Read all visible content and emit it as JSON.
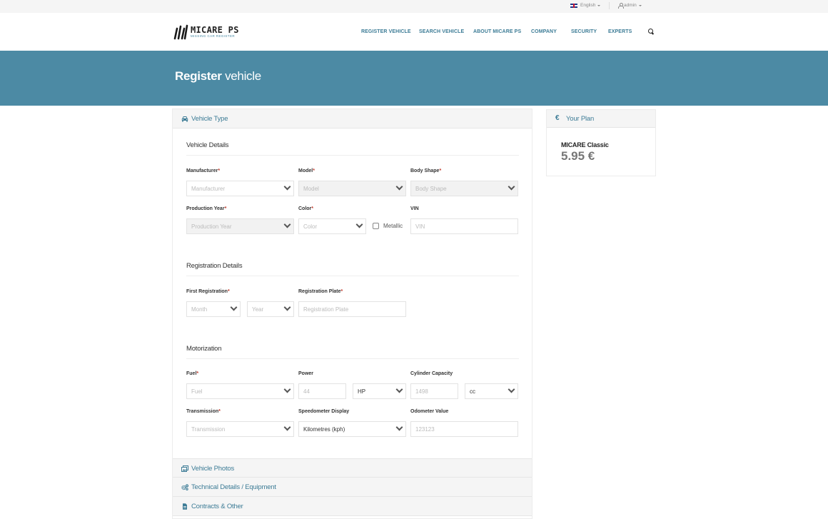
{
  "topbar": {
    "language": "English",
    "user": "admin"
  },
  "brand": {
    "name": "MICARE PS",
    "tagline": "MISSING CAR REGISTER"
  },
  "nav": {
    "items": [
      "REGISTER VEHICLE",
      "SEARCH VEHICLE",
      "ABOUT MICARE PS",
      "COMPANY",
      "SECURITY",
      "EXPERTS"
    ]
  },
  "banner": {
    "title_bold": "Register",
    "title_light": "vehicle"
  },
  "accordion": {
    "vehicle_type": "Vehicle Type",
    "vehicle_photos": "Vehicle Photos",
    "technical_details": "Technical Details / Equipment",
    "contracts": "Contracts & Other"
  },
  "vehicle_details": {
    "title": "Vehicle Details",
    "manufacturer_label": "Manufacturer",
    "manufacturer_placeholder": "Manufacturer",
    "model_label": "Model",
    "model_placeholder": "Model",
    "body_shape_label": "Body Shape",
    "body_shape_placeholder": "Body Shape",
    "production_year_label": "Production Year",
    "production_year_placeholder": "Production Year",
    "color_label": "Color",
    "color_placeholder": "Color",
    "metallic_label": "Metallic",
    "vin_label": "VIN",
    "vin_placeholder": "VIN"
  },
  "registration_details": {
    "title": "Registration Details",
    "first_registration_label": "First Registration",
    "month_placeholder": "Month",
    "year_placeholder": "Year",
    "plate_label": "Registration Plate",
    "plate_placeholder": "Registration Plate"
  },
  "motorization": {
    "title": "Motorization",
    "fuel_label": "Fuel",
    "fuel_placeholder": "Fuel",
    "power_label": "Power",
    "power_placeholder": "44",
    "power_unit": "HP",
    "cylinder_label": "Cylinder Capacity",
    "cylinder_placeholder": "1498",
    "cylinder_unit": "cc",
    "transmission_label": "Transmission",
    "transmission_placeholder": "Transmission",
    "speedometer_label": "Speedometer Display",
    "speedometer_value": "Kilometres (kph)",
    "odometer_label": "Odometer Value",
    "odometer_placeholder": "123123"
  },
  "plan": {
    "title": "Your Plan",
    "name": "MICARE Classic",
    "price": "5.95 €"
  },
  "required_mark": "*",
  "icons": [
    "flag-icon",
    "user-icon",
    "search-icon",
    "car-icon",
    "photos-icon",
    "cogs-icon",
    "file-icon",
    "euro-icon",
    "chevron-down-icon"
  ],
  "colors": {
    "accent": "#3d7c96",
    "banner": "#4c8aa4",
    "required": "#c0392b"
  }
}
